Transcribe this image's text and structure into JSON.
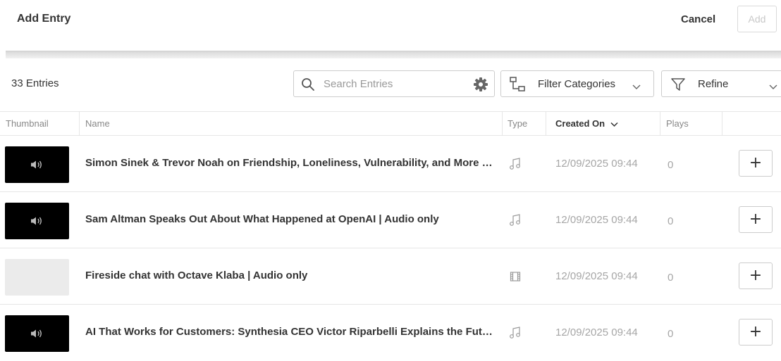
{
  "header": {
    "title": "Add Entry",
    "cancel_label": "Cancel",
    "add_label": "Add"
  },
  "toolbar": {
    "entry_count": "33 Entries",
    "search_placeholder": "Search Entries",
    "filter_label": "Filter Categories",
    "refine_label": "Refine"
  },
  "table": {
    "columns": [
      "Thumbnail",
      "Name",
      "Type",
      "Created On",
      "Plays"
    ],
    "sorted_column": "Created On",
    "rows": [
      {
        "thumbnail": "audio",
        "name": "Simon Sinek & Trevor Noah on Friendship, Loneliness, Vulnerability, and More | Audio only",
        "type_icon": "audio-type-icon",
        "created": "12/09/2025 09:44",
        "plays": "0"
      },
      {
        "thumbnail": "audio",
        "name": "Sam Altman Speaks Out About What Happened at OpenAI  |  Audio only",
        "type_icon": "audio-type-icon",
        "created": "12/09/2025 09:44",
        "plays": "0"
      },
      {
        "thumbnail": "blank",
        "name": "Fireside chat with Octave Klaba | Audio only",
        "type_icon": "video-type-icon",
        "created": "12/09/2025 09:44",
        "plays": "0"
      },
      {
        "thumbnail": "audio",
        "name": "AI That Works for Customers:  Synthesia CEO Victor Riparbelli Explains the Future | Audio only",
        "type_icon": "audio-type-icon",
        "created": "12/09/2025 09:44",
        "plays": "0"
      }
    ],
    "add_row_label": "+"
  },
  "colors": {
    "text": "#333333",
    "muted": "#a6a6a6",
    "border": "#cccccc",
    "audio_thumb": "#000000",
    "blank_thumb": "#ebebeb"
  }
}
